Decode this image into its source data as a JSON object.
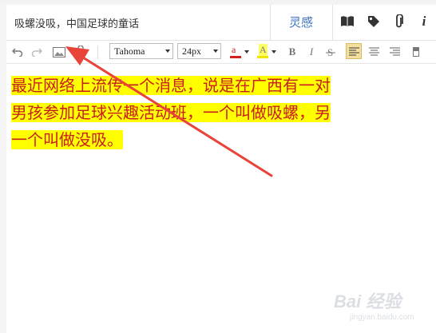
{
  "title": "吸螺没吸，中国足球的童话",
  "inspire_label": "灵感",
  "toolbar": {
    "font_family": "Tahoma",
    "font_size": "24px",
    "font_color_glyph": "a",
    "highlight_glyph": "A",
    "bold": "B",
    "italic": "I",
    "font_color": "#d21f1f",
    "highlight_color": "#f2e600"
  },
  "content": {
    "line1": "最近网络上流传一个消息，说是在广西有一对",
    "line2": "男孩参加足球兴趣活动班，一个叫做吸螺，另",
    "line3": "一个叫做没吸。",
    "text_color": "#c81e1e",
    "highlight": "#ffff00"
  },
  "watermark": {
    "brand": "Bai 经验",
    "url": "jingyan.baidu.com"
  },
  "annotation_color": "#e8443a"
}
